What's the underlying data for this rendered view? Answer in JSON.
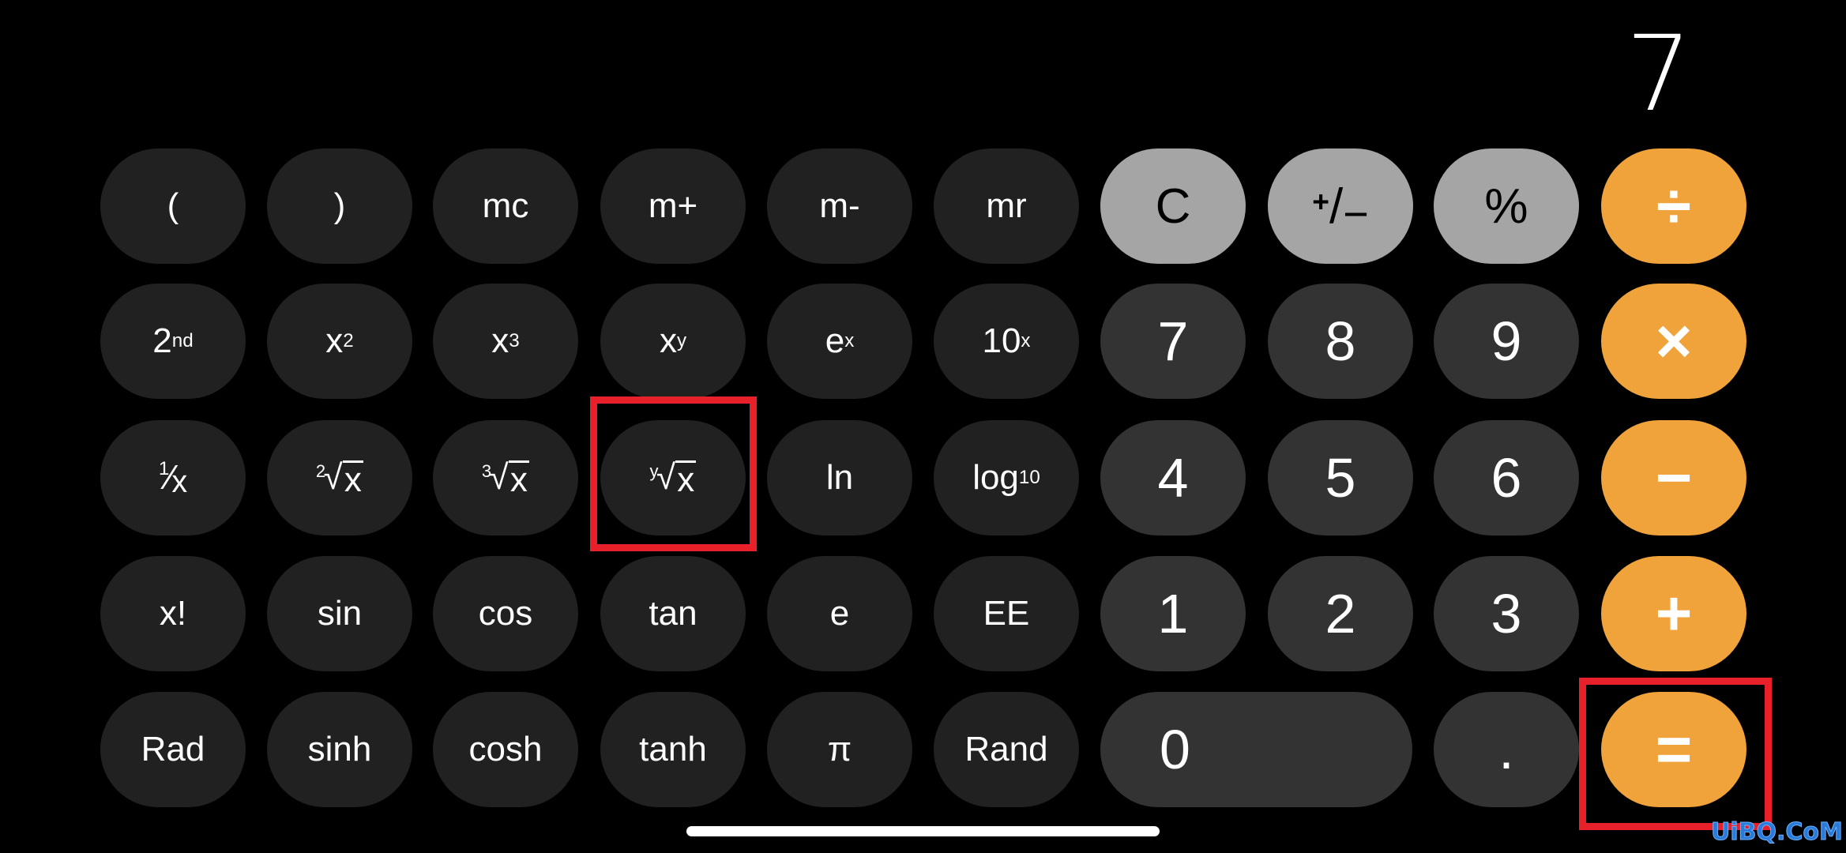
{
  "display": {
    "value": "7"
  },
  "rows": [
    [
      {
        "name": "open-paren-button",
        "label": "(",
        "kind": "sci"
      },
      {
        "name": "close-paren-button",
        "label": ")",
        "kind": "sci"
      },
      {
        "name": "memory-clear-button",
        "label": "mc",
        "kind": "sci"
      },
      {
        "name": "memory-add-button",
        "label": "m+",
        "kind": "sci"
      },
      {
        "name": "memory-subtract-button",
        "label": "m-",
        "kind": "sci"
      },
      {
        "name": "memory-recall-button",
        "label": "mr",
        "kind": "sci"
      },
      {
        "name": "clear-button",
        "label": "C",
        "kind": "fn"
      },
      {
        "name": "sign-toggle-button",
        "label": "+/-",
        "kind": "fn",
        "render": "pm"
      },
      {
        "name": "percent-button",
        "label": "%",
        "kind": "fn"
      },
      {
        "name": "divide-button",
        "label": "÷",
        "kind": "op"
      }
    ],
    [
      {
        "name": "second-function-button",
        "label": "2",
        "sup": "nd",
        "kind": "sci"
      },
      {
        "name": "square-button",
        "label": "x",
        "sup": "2",
        "kind": "sci"
      },
      {
        "name": "cube-button",
        "label": "x",
        "sup": "3",
        "kind": "sci"
      },
      {
        "name": "power-button",
        "label": "x",
        "sup": "y",
        "kind": "sci"
      },
      {
        "name": "exp-button",
        "label": "e",
        "sup": "x",
        "kind": "sci"
      },
      {
        "name": "ten-power-button",
        "label": "10",
        "sup": "x",
        "kind": "sci"
      },
      {
        "name": "digit-7-button",
        "label": "7",
        "kind": "num"
      },
      {
        "name": "digit-8-button",
        "label": "8",
        "kind": "num"
      },
      {
        "name": "digit-9-button",
        "label": "9",
        "kind": "num"
      },
      {
        "name": "multiply-button",
        "label": "×",
        "kind": "op"
      }
    ],
    [
      {
        "name": "reciprocal-button",
        "label": "x",
        "num": "1",
        "kind": "sci",
        "render": "frac"
      },
      {
        "name": "square-root-button",
        "label": "x",
        "idx": "2",
        "kind": "sci",
        "render": "root"
      },
      {
        "name": "cube-root-button",
        "label": "x",
        "idx": "3",
        "kind": "sci",
        "render": "root"
      },
      {
        "name": "yth-root-button",
        "label": "x",
        "idx": "y",
        "kind": "sci",
        "render": "root"
      },
      {
        "name": "natural-log-button",
        "label": "ln",
        "kind": "sci"
      },
      {
        "name": "log10-button",
        "label": "log",
        "sub": "10",
        "kind": "sci"
      },
      {
        "name": "digit-4-button",
        "label": "4",
        "kind": "num"
      },
      {
        "name": "digit-5-button",
        "label": "5",
        "kind": "num"
      },
      {
        "name": "digit-6-button",
        "label": "6",
        "kind": "num"
      },
      {
        "name": "subtract-button",
        "label": "−",
        "kind": "op"
      }
    ],
    [
      {
        "name": "factorial-button",
        "label": "x!",
        "kind": "sci"
      },
      {
        "name": "sin-button",
        "label": "sin",
        "kind": "sci"
      },
      {
        "name": "cos-button",
        "label": "cos",
        "kind": "sci"
      },
      {
        "name": "tan-button",
        "label": "tan",
        "kind": "sci"
      },
      {
        "name": "euler-button",
        "label": "e",
        "kind": "sci"
      },
      {
        "name": "exponent-entry-button",
        "label": "EE",
        "kind": "sci"
      },
      {
        "name": "digit-1-button",
        "label": "1",
        "kind": "num"
      },
      {
        "name": "digit-2-button",
        "label": "2",
        "kind": "num"
      },
      {
        "name": "digit-3-button",
        "label": "3",
        "kind": "num"
      },
      {
        "name": "add-button",
        "label": "+",
        "kind": "op"
      }
    ],
    [
      {
        "name": "rad-deg-toggle-button",
        "label": "Rad",
        "kind": "sci"
      },
      {
        "name": "sinh-button",
        "label": "sinh",
        "kind": "sci"
      },
      {
        "name": "cosh-button",
        "label": "cosh",
        "kind": "sci"
      },
      {
        "name": "tanh-button",
        "label": "tanh",
        "kind": "sci"
      },
      {
        "name": "pi-button",
        "label": "π",
        "kind": "sci"
      },
      {
        "name": "random-button",
        "label": "Rand",
        "kind": "sci"
      },
      {
        "name": "digit-0-button",
        "label": "0",
        "kind": "num",
        "wide": true
      },
      {
        "name": "decimal-button",
        "label": ".",
        "kind": "num"
      },
      {
        "name": "equals-button",
        "label": "=",
        "kind": "op"
      }
    ]
  ],
  "highlights": [
    {
      "name": "highlight-yth-root",
      "target": "yth-root-button"
    },
    {
      "name": "highlight-equals",
      "target": "equals-button"
    }
  ],
  "colors": {
    "background": "#000000",
    "scientific_key": "#212121",
    "digit_key": "#333333",
    "function_key": "#a5a5a5",
    "operator_key": "#f1a33b",
    "highlight": "#e8202a",
    "watermark": "#2a7ad8"
  },
  "watermark": {
    "text": "UiBQ.CoM"
  }
}
